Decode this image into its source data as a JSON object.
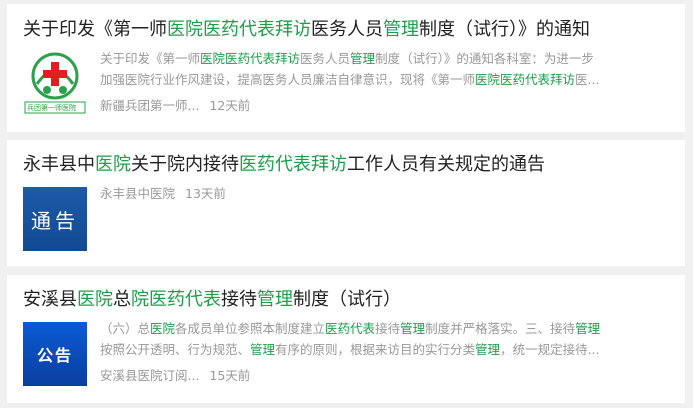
{
  "results": [
    {
      "title_parts": [
        {
          "t": "关于印发《第一师",
          "h": false
        },
        {
          "t": "医院医药代表拜访",
          "h": true
        },
        {
          "t": "医务人员",
          "h": false
        },
        {
          "t": "管理",
          "h": true
        },
        {
          "t": "制度（试行）》的通知",
          "h": false
        }
      ],
      "thumb": {
        "type": "logo",
        "text": "兵团第一师医院"
      },
      "snippet_lines": [
        [
          {
            "t": "关于印发《第一师",
            "h": false
          },
          {
            "t": "医院医药代表拜访",
            "h": true
          },
          {
            "t": "医务人员",
            "h": false
          },
          {
            "t": "管理",
            "h": true
          },
          {
            "t": "制度（试行）》的通知各科室：为进一步",
            "h": false
          }
        ],
        [
          {
            "t": "加强医院行业作风建设，提高医务人员廉洁自律意识，现将《第一师",
            "h": false
          },
          {
            "t": "医院医药代表拜访",
            "h": true
          },
          {
            "t": "医...",
            "h": false
          }
        ]
      ],
      "source": "新疆兵团第一师...",
      "time": "12天前"
    },
    {
      "title_parts": [
        {
          "t": "永丰县中",
          "h": false
        },
        {
          "t": "医院",
          "h": true
        },
        {
          "t": "关于院内接待",
          "h": false
        },
        {
          "t": "医药代表拜访",
          "h": true
        },
        {
          "t": "工作人员有关规定的通告",
          "h": false
        }
      ],
      "thumb": {
        "type": "blue",
        "text": "通告"
      },
      "snippet_lines": [],
      "source": "永丰县中医院",
      "time": "13天前"
    },
    {
      "title_parts": [
        {
          "t": "安溪县",
          "h": false
        },
        {
          "t": "医院",
          "h": true
        },
        {
          "t": "总",
          "h": false
        },
        {
          "t": "院医药代表",
          "h": true
        },
        {
          "t": "接待",
          "h": false
        },
        {
          "t": "管理",
          "h": true
        },
        {
          "t": "制度（试行）",
          "h": false
        }
      ],
      "thumb": {
        "type": "blue2",
        "text": "公告"
      },
      "snippet_lines": [
        [
          {
            "t": "（六）总",
            "h": false
          },
          {
            "t": "医院",
            "h": true
          },
          {
            "t": "各成员单位参照本制度建立",
            "h": false
          },
          {
            "t": "医药代表",
            "h": true
          },
          {
            "t": "接待",
            "h": false
          },
          {
            "t": "管理",
            "h": true
          },
          {
            "t": "制度并严格落实。三、接待",
            "h": false
          },
          {
            "t": "管理",
            "h": true
          }
        ],
        [
          {
            "t": "按照公开透明、行为规范、",
            "h": false
          },
          {
            "t": "管理",
            "h": true
          },
          {
            "t": "有序的原则，根据来访目的实行分类",
            "h": false
          },
          {
            "t": "管理",
            "h": true
          },
          {
            "t": "，统一规定接待...",
            "h": false
          }
        ]
      ],
      "source": "安溪县医院订阅...",
      "time": "15天前"
    }
  ],
  "colors": {
    "highlight": "#1e9e4b",
    "text": "#222222",
    "muted": "#999999",
    "background": "#f0f0f0"
  }
}
